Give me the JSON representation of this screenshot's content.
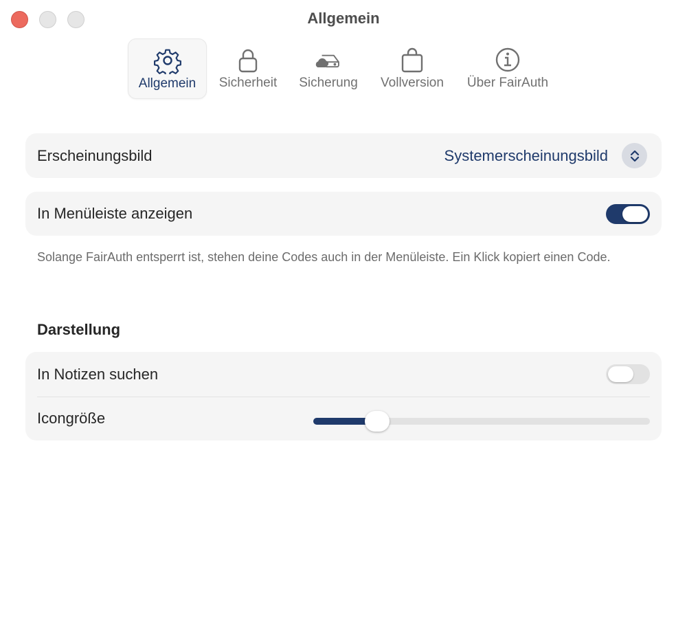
{
  "window": {
    "title": "Allgemein"
  },
  "toolbar": {
    "tabs": [
      {
        "label": "Allgemein",
        "icon": "gear-icon",
        "active": true
      },
      {
        "label": "Sicherheit",
        "icon": "lock-icon",
        "active": false
      },
      {
        "label": "Sicherung",
        "icon": "cloud-drive-icon",
        "active": false
      },
      {
        "label": "Vollversion",
        "icon": "shopping-bag-icon",
        "active": false
      },
      {
        "label": "Über FairAuth",
        "icon": "info-icon",
        "active": false
      }
    ]
  },
  "appearance": {
    "label": "Erscheinungsbild",
    "value": "Systemerscheinungsbild"
  },
  "menubar": {
    "label": "In Menüleiste anzeigen",
    "enabled": true,
    "note": "Solange FairAuth entsperrt ist, stehen deine Codes auch in der Menüleiste. Ein Klick kopiert einen Code."
  },
  "display": {
    "heading": "Darstellung",
    "search_notes": {
      "label": "In Notizen suchen",
      "enabled": false
    },
    "icon_size": {
      "label": "Icongröße",
      "value_fraction": 0.19
    }
  },
  "colors": {
    "accent": "#1f3a6b",
    "card": "#f5f5f5",
    "close": "#ec6a5e"
  }
}
